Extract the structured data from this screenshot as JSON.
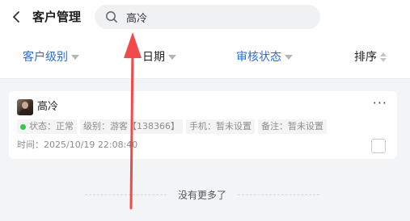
{
  "header": {
    "title": "客户管理",
    "back_icon": "chevron-left-icon",
    "search": {
      "value": "高冷",
      "icon": "search-icon"
    }
  },
  "filters": {
    "level": "客户级别",
    "date": "日期",
    "audit": "审核状态",
    "sort": "排序",
    "active_color": "#2a6fd6"
  },
  "card": {
    "name": "高冷",
    "more": "···",
    "status": "状态：正常",
    "status_color": "#2ecc40",
    "level": "级别：游客【138366】",
    "phone": "手机：暂未设置",
    "note": "备注：暂未设置",
    "time": "时间：2025/10/19 22:08:40"
  },
  "footer": {
    "no_more": "没有更多了"
  },
  "annotation": {
    "arrow_color": "#f04a4a"
  }
}
